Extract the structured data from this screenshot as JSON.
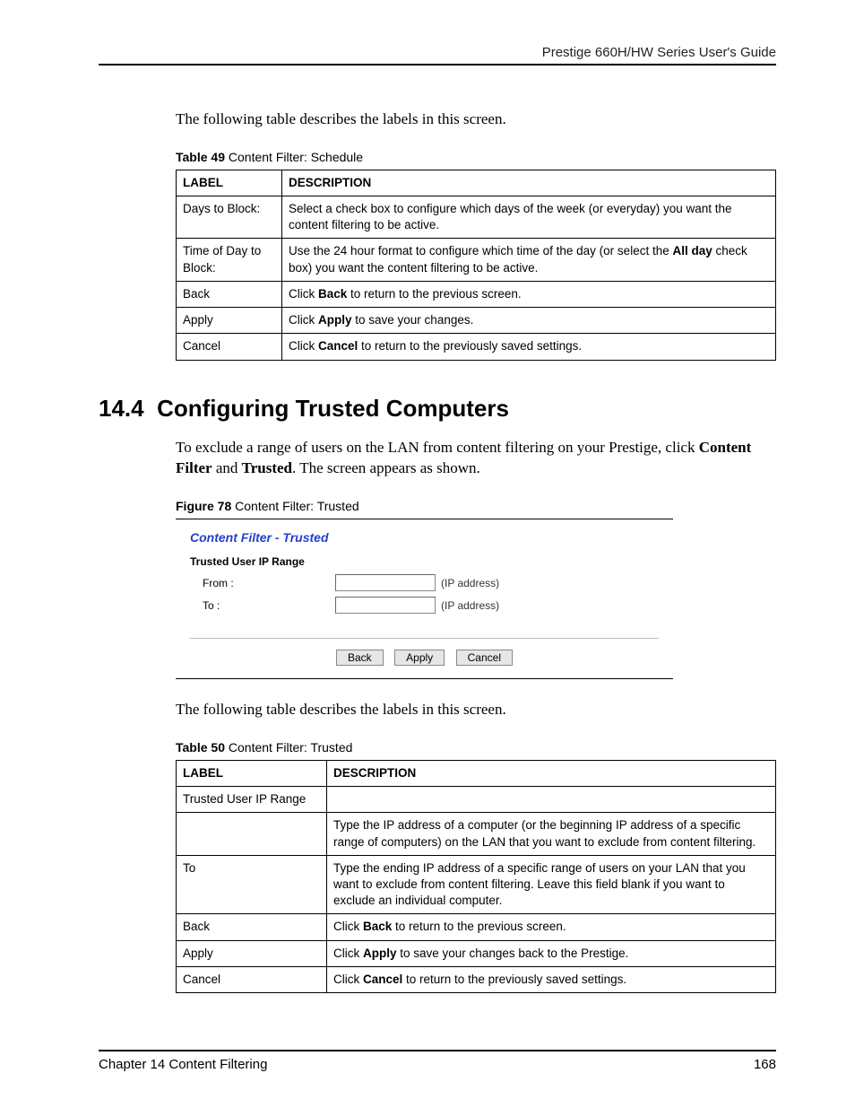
{
  "header": {
    "guide_title": "Prestige 660H/HW Series User's Guide"
  },
  "intro1": "The following table describes the labels in this screen.",
  "table49": {
    "caption_bold": "Table 49",
    "caption_rest": "   Content Filter: Schedule",
    "head": {
      "label": "LABEL",
      "desc": "DESCRIPTION"
    },
    "rows": [
      {
        "label": "Days to Block:",
        "desc": "Select a check box to configure which days of the week (or everyday) you want the content filtering to be active."
      },
      {
        "label": "Time of Day to Block:",
        "desc_pre": "Use the 24 hour format to configure which time of the day (or select the ",
        "desc_bold": "All day",
        "desc_post": " check box) you want the content filtering to be active."
      },
      {
        "label": "Back",
        "desc_pre": "Click ",
        "desc_bold": "Back",
        "desc_post": " to return to the previous screen."
      },
      {
        "label": "Apply",
        "desc_pre": "Click ",
        "desc_bold": "Apply",
        "desc_post": " to save your changes."
      },
      {
        "label": "Cancel",
        "desc_pre": "Click ",
        "desc_bold": "Cancel",
        "desc_post": " to return to the previously saved settings."
      }
    ]
  },
  "section": {
    "number": "14.4",
    "title": "Configuring Trusted Computers"
  },
  "section_body": {
    "pre": "To exclude a range of users on the LAN from content filtering on your Prestige, click ",
    "b1": "Content Filter",
    "mid": " and ",
    "b2": "Trusted",
    "post": ". The screen appears as shown."
  },
  "figure78": {
    "caption_bold": "Figure 78",
    "caption_rest": "   Content Filter: Trusted",
    "heading": "Content Filter - Trusted",
    "range_label": "Trusted User IP Range",
    "rows": {
      "from_label": "From :",
      "to_label": "To :",
      "hint": "(IP address)"
    },
    "buttons": {
      "back": "Back",
      "apply": "Apply",
      "cancel": "Cancel"
    }
  },
  "intro2": "The following table describes the labels in this screen.",
  "table50": {
    "caption_bold": "Table 50",
    "caption_rest": "   Content Filter: Trusted",
    "head": {
      "label": "LABEL",
      "desc": "DESCRIPTION"
    },
    "rows": [
      {
        "label": "Trusted User IP Range",
        "desc": ""
      },
      {
        "label": "",
        "desc": "Type the IP address of a computer (or the beginning IP address of a specific range of computers) on the LAN that you want to exclude from content filtering."
      },
      {
        "label": "To",
        "desc": "Type the ending IP address of a specific range of users on your LAN that you want to exclude from content filtering. Leave this field blank if you want to exclude an individual computer."
      },
      {
        "label": "Back",
        "desc_pre": "Click ",
        "desc_bold": "Back",
        "desc_post": " to return to the previous screen."
      },
      {
        "label": "Apply",
        "desc_pre": "Click ",
        "desc_bold": "Apply",
        "desc_post": " to save your changes back to the Prestige."
      },
      {
        "label": "Cancel",
        "desc_pre": "Click ",
        "desc_bold": "Cancel",
        "desc_post": " to return to the previously saved settings."
      }
    ]
  },
  "footer": {
    "left": "Chapter 14 Content Filtering",
    "right": "168"
  }
}
